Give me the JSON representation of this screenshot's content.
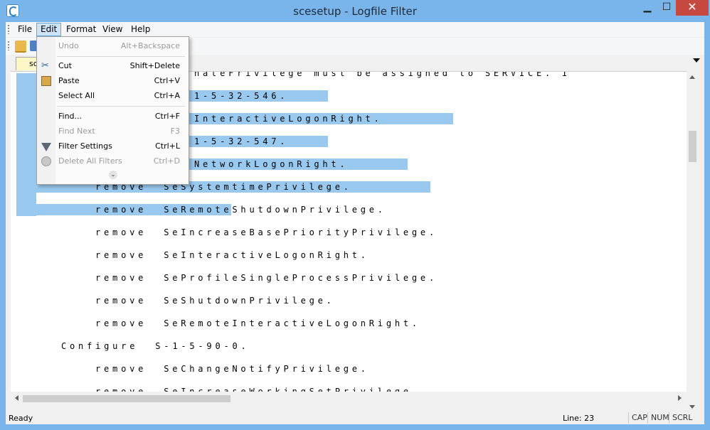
{
  "window": {
    "title": "scesetup - Logfile Filter"
  },
  "menubar": {
    "items": [
      "File",
      "Edit",
      "Format",
      "View",
      "Help"
    ]
  },
  "tab": {
    "label": "sc"
  },
  "edit_menu": {
    "items": [
      {
        "label": "Undo",
        "shortcut": "Alt+Backspace",
        "disabled": true,
        "icon": ""
      },
      {
        "label": "Cut",
        "shortcut": "Shift+Delete",
        "disabled": false,
        "icon": "scissors-icon"
      },
      {
        "label": "Paste",
        "shortcut": "Ctrl+V",
        "disabled": false,
        "icon": "paste-icon"
      },
      {
        "label": "Select All",
        "shortcut": "Ctrl+A",
        "disabled": false,
        "icon": ""
      },
      {
        "label": "Find...",
        "shortcut": "Ctrl+F",
        "disabled": false,
        "icon": ""
      },
      {
        "label": "Find Next",
        "shortcut": "F3",
        "disabled": true,
        "icon": ""
      },
      {
        "label": "Filter Settings",
        "shortcut": "Ctrl+L",
        "disabled": false,
        "icon": "funnel-icon"
      },
      {
        "label": "Delete All Filters",
        "shortcut": "Ctrl+D",
        "disabled": true,
        "icon": "delete-filters-icon"
      }
    ]
  },
  "editor": {
    "lines": [
      "nateFrivilege must be assigned to SERVICE. I",
      "1-5-32-546.",
      "InteractiveLogonRight.",
      "1-5-32-547.",
      "NetworkLogonRight.",
      "remove  SeSystemtimePrivilege.",
      "remove  SeRemoteShutdownPrivilege.",
      "remove  SeIncreaseBasePriorityPrivilege.",
      "remove  SeInteractiveLogonRight.",
      "remove  SeProfileSingleProcessPrivilege.",
      "remove  SeShutdownPrivilege.",
      "remove  SeRemoteInteractiveLogonRight.",
      "Configure  S-1-5-90-0.",
      "remove  SeChangeNotifyPrivilege.",
      "remove  SeIncreaseWorkingSetPrivilege."
    ]
  },
  "status": {
    "ready": "Ready",
    "line": "Line: 23",
    "cap": "CAP",
    "num": "NUM",
    "scrl": "SCRL"
  }
}
